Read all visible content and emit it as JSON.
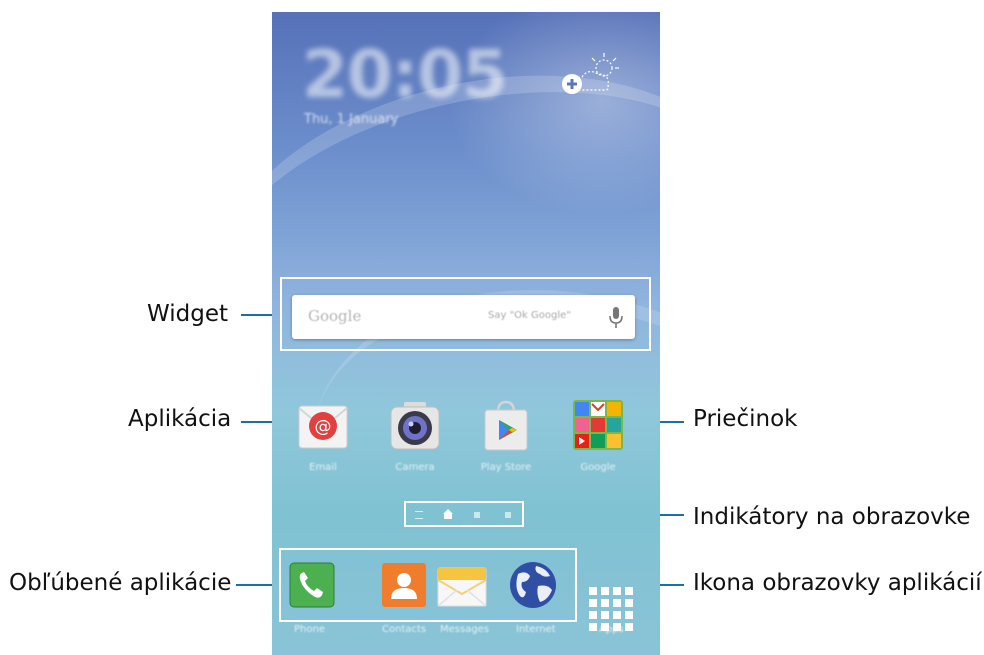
{
  "callouts": {
    "widget": "Widget",
    "app": "Aplikácia",
    "favorites": "Obľúbené aplikácie",
    "folder": "Priečinok",
    "indicators": "Indikátory na obrazovke",
    "apps_screen_icon": "Ikona obrazovky aplikácií"
  },
  "home": {
    "clock": "20:05",
    "date": "Thu, 1 January",
    "search": {
      "brand": "Google",
      "hint": "Say \"Ok Google\""
    },
    "apps": [
      {
        "label": "Email",
        "icon": "email-icon"
      },
      {
        "label": "Camera",
        "icon": "camera-icon"
      },
      {
        "label": "Play Store",
        "icon": "play-store-icon"
      },
      {
        "label": "Google",
        "icon": "google-folder-icon"
      }
    ],
    "dock": [
      {
        "label": "Phone",
        "icon": "phone-icon"
      },
      {
        "label": "Contacts",
        "icon": "contacts-icon"
      },
      {
        "label": "Messages",
        "icon": "messages-icon"
      },
      {
        "label": "Internet",
        "icon": "internet-icon"
      },
      {
        "label": "Apps",
        "icon": "apps-grid-icon"
      }
    ]
  },
  "colors": {
    "leader_line": "#1a6fa8",
    "highlight_frame": "#ffffff"
  }
}
